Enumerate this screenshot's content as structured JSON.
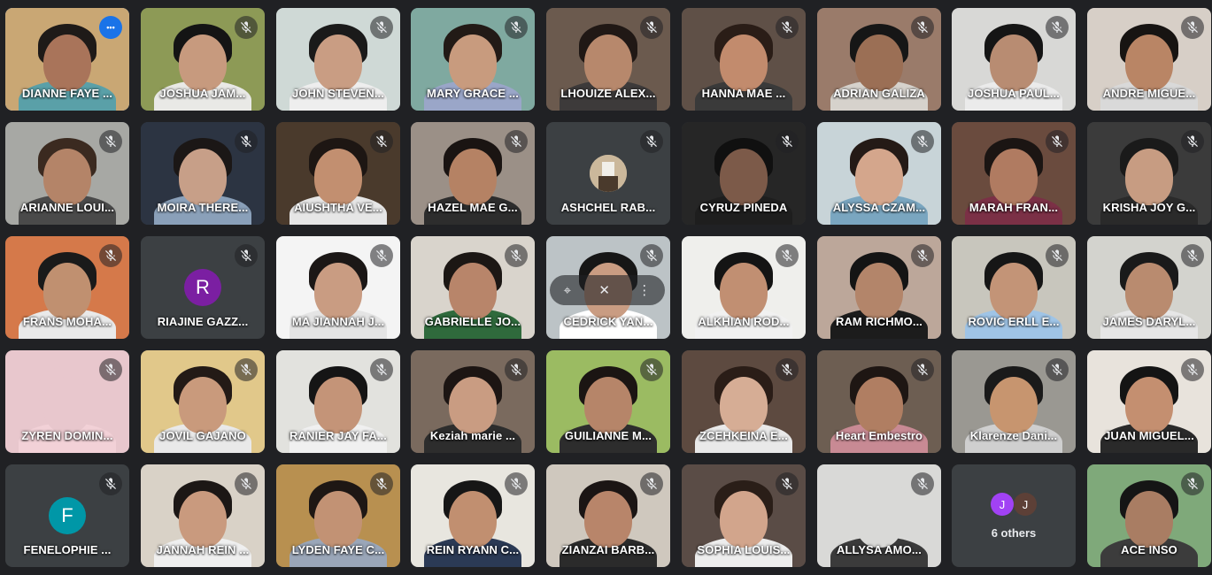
{
  "meeting": {
    "participants": [
      {
        "name": "DIANNE FAYE ...",
        "kind": "video",
        "bg": "#c9a774",
        "skin": "#a9745a",
        "hair": "#1e1a18",
        "shirt": "#5aa0a8",
        "self": true
      },
      {
        "name": "JOSHUA JAM...",
        "kind": "video",
        "bg": "#8d9a56",
        "skin": "#c79a7e",
        "hair": "#141414",
        "shirt": "#e9e9e6"
      },
      {
        "name": "JOHN STEVEN...",
        "kind": "video",
        "bg": "#cfd9d6",
        "skin": "#c99d83",
        "hair": "#1a1a1a",
        "shirt": "#eeeeee"
      },
      {
        "name": "MARY GRACE ...",
        "kind": "video",
        "bg": "#7fa9a0",
        "skin": "#c89b7e",
        "hair": "#221a16",
        "shirt": "#9aa6c8"
      },
      {
        "name": "LHOUIZE ALEX...",
        "kind": "video",
        "bg": "#6b5a4e",
        "skin": "#b7886c",
        "hair": "#201815",
        "shirt": "#3d3a3a"
      },
      {
        "name": "HANNA MAE ...",
        "kind": "video",
        "bg": "#5f5047",
        "skin": "#c28b6d",
        "hair": "#2a1d17",
        "shirt": "#3a3a3a"
      },
      {
        "name": "ADRIAN GALIZA",
        "kind": "video",
        "bg": "#9a7b6a",
        "skin": "#9b6f55",
        "hair": "#161616",
        "shirt": "#d6d2cc"
      },
      {
        "name": "JOSHUA PAUL...",
        "kind": "video",
        "bg": "#d8d8d6",
        "skin": "#b88c72",
        "hair": "#151515",
        "shirt": "#ebebeb"
      },
      {
        "name": "ANDRE MIGUE...",
        "kind": "video",
        "bg": "#d7cfc7",
        "skin": "#b98565",
        "hair": "#171412",
        "shirt": "#d9d9d9"
      },
      {
        "name": "ARIANNE LOUI...",
        "kind": "video",
        "bg": "#a7a8a4",
        "skin": "#b48468",
        "hair": "#3b2a20",
        "shirt": "#4a4a4a"
      },
      {
        "name": "MOIRA THERE...",
        "kind": "video",
        "bg": "#2c3442",
        "skin": "#c79f88",
        "hair": "#1b1716",
        "shirt": "#8aa0b9"
      },
      {
        "name": "AIUSHTHA VE...",
        "kind": "video",
        "bg": "#4a3a2c",
        "skin": "#c28f70",
        "hair": "#1d1613",
        "shirt": "#e6e6e6"
      },
      {
        "name": "HAZEL MAE G...",
        "kind": "video",
        "bg": "#9b9087",
        "skin": "#b58264",
        "hair": "#1a1412",
        "shirt": "#2d2d2d"
      },
      {
        "name": "ASHCHEL RAB...",
        "kind": "avatar-img",
        "bg": "#3c4043"
      },
      {
        "name": "CYRUZ PINEDA",
        "kind": "video",
        "bg": "#262626",
        "skin": "#7c5a49",
        "hair": "#101010",
        "shirt": "#1e1e1e"
      },
      {
        "name": "ALYSSA CZAM...",
        "kind": "video",
        "bg": "#c8d4d8",
        "skin": "#d4a68c",
        "hair": "#241a16",
        "shirt": "#7aa6c0"
      },
      {
        "name": "MARAH FRAN...",
        "kind": "video",
        "bg": "#6a4b3e",
        "skin": "#b07b61",
        "hair": "#1b1513",
        "shirt": "#7b3046"
      },
      {
        "name": "KRISHA JOY G...",
        "kind": "video",
        "bg": "#3b3b3b",
        "skin": "#c79c82",
        "hair": "#1a1a1a",
        "shirt": "#2a2a2a"
      },
      {
        "name": "FRANS MOHA...",
        "kind": "video",
        "bg": "#d5794a",
        "skin": "#c09070",
        "hair": "#1a1a1a",
        "shirt": "#e9e9e9"
      },
      {
        "name": "RIAJINE GAZZ...",
        "kind": "avatar",
        "letter": "R",
        "avatar_color": "#7b1fa2"
      },
      {
        "name": "MA JIANNAH J...",
        "kind": "video",
        "bg": "#f4f4f4",
        "skin": "#c99c82",
        "hair": "#1b1716",
        "shirt": "#e4e4e4"
      },
      {
        "name": "GABRIELLE JO...",
        "kind": "video",
        "bg": "#d9d4cc",
        "skin": "#b8856a",
        "hair": "#1c1714",
        "shirt": "#2f6a3c"
      },
      {
        "name": "CEDRICK YAN...",
        "kind": "video",
        "bg": "#bcc3c6",
        "skin": "#c99c82",
        "hair": "#161616",
        "shirt": "#ffffff",
        "hover": true
      },
      {
        "name": "ALKHIAN ROD...",
        "kind": "video",
        "bg": "#efefec",
        "skin": "#c18f72",
        "hair": "#141414",
        "shirt": "#f1f1f1"
      },
      {
        "name": "RAM RICHMO...",
        "kind": "video",
        "bg": "#bca79a",
        "skin": "#b3856a",
        "hair": "#141414",
        "shirt": "#1c1c1c"
      },
      {
        "name": "ROVIC ERLL E...",
        "kind": "video",
        "bg": "#c8c6bd",
        "skin": "#c39477",
        "hair": "#161616",
        "shirt": "#9fc4e6"
      },
      {
        "name": "JAMES DARYL...",
        "kind": "video",
        "bg": "#d3d3ce",
        "skin": "#b98b6f",
        "hair": "#1a1a1a",
        "shirt": "#e6e6e6"
      },
      {
        "name": "ZYREN DOMIN...",
        "kind": "video",
        "bg": "#e8c7cd",
        "skin": "#e8c7cd",
        "hair": "#e8c7cd",
        "shirt": "#f2d1d7"
      },
      {
        "name": "JOVIL GAJANO",
        "kind": "video",
        "bg": "#e1c88a",
        "skin": "#c99a7c",
        "hair": "#231a16",
        "shirt": "#e9e9e9"
      },
      {
        "name": "RANIER JAY FA...",
        "kind": "video",
        "bg": "#e2e2de",
        "skin": "#c49478",
        "hair": "#151515",
        "shirt": "#f0f0f0"
      },
      {
        "name": "Keziah marie ...",
        "kind": "video",
        "bg": "#7a6a5e",
        "skin": "#c99c82",
        "hair": "#1c1513",
        "shirt": "#2d2d2d"
      },
      {
        "name": "GUILIANNE M...",
        "kind": "video",
        "bg": "#9bbb62",
        "skin": "#b68569",
        "hair": "#1b1513",
        "shirt": "#2d2d2d"
      },
      {
        "name": "ZCEHKEINA E...",
        "kind": "video",
        "bg": "#5d4a40",
        "skin": "#d6ad95",
        "hair": "#2a1d17",
        "shirt": "#e9e9e9"
      },
      {
        "name": "Heart Embestro",
        "kind": "video",
        "bg": "#6d5e52",
        "skin": "#b07e62",
        "hair": "#1e1613",
        "shirt": "#c88a94"
      },
      {
        "name": "Klarenze Dani...",
        "kind": "video",
        "bg": "#9a9892",
        "skin": "#c7956f",
        "hair": "#1a1a1a",
        "shirt": "#cfcfcf"
      },
      {
        "name": "JUAN MIGUEL...",
        "kind": "video",
        "bg": "#e8e3dc",
        "skin": "#c48f70",
        "hair": "#141414",
        "shirt": "#2a2a2a"
      },
      {
        "name": "FENELOPHIE ...",
        "kind": "avatar",
        "letter": "F",
        "avatar_color": "#0097a7"
      },
      {
        "name": "JANNAH REIN ...",
        "kind": "video",
        "bg": "#d9d2c7",
        "skin": "#c99a7e",
        "hair": "#1c1715",
        "shirt": "#efefef"
      },
      {
        "name": "LYDEN FAYE C...",
        "kind": "video",
        "bg": "#b89050",
        "skin": "#c29274",
        "hair": "#1e1714",
        "shirt": "#9aa6b8"
      },
      {
        "name": "REIN RYANN C...",
        "kind": "video",
        "bg": "#e8e6df",
        "skin": "#c18f70",
        "hair": "#161616",
        "shirt": "#2b3a55"
      },
      {
        "name": "ZIANZAI BARB...",
        "kind": "video",
        "bg": "#cfc8be",
        "skin": "#b8856a",
        "hair": "#1b1514",
        "shirt": "#2b2b2b"
      },
      {
        "name": "SOPHIA LOUIS...",
        "kind": "video",
        "bg": "#5a4c46",
        "skin": "#d2a58c",
        "hair": "#2a1e18",
        "shirt": "#ededed"
      },
      {
        "name": "ALLYSA AMO...",
        "kind": "video",
        "bg": "#d9d9d7",
        "skin": "#d9d9d7",
        "hair": "#d9d9d7",
        "shirt": "#3b3b3b"
      },
      {
        "name": "6 others",
        "kind": "others",
        "initials": [
          "J",
          "J"
        ],
        "initial_colors": [
          "#a142f4",
          "#5d4037"
        ]
      },
      {
        "name": "ACE INSO",
        "kind": "video",
        "bg": "#7fa97a",
        "skin": "#a97d63",
        "hair": "#151515",
        "shirt": "#3c3c3c"
      }
    ]
  },
  "icons": {
    "muted": "mic-off-icon",
    "more": "more-options-icon",
    "pin": "pin-icon"
  },
  "colors": {
    "tile_bg": "#3c4043",
    "page_bg": "#202124",
    "active_outline": "#8ab4f8",
    "accent": "#1a73e8"
  }
}
